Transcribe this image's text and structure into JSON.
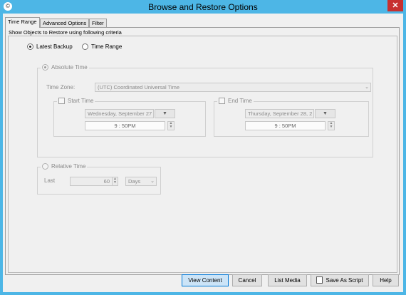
{
  "window": {
    "title": "Browse and Restore Options",
    "close_glyph": "✕",
    "app_icon": "©"
  },
  "tabs": [
    {
      "label": "Time Range",
      "active": true
    },
    {
      "label": "Advanced Options",
      "active": false
    },
    {
      "label": "Filter",
      "active": false
    }
  ],
  "panel": {
    "caption": "Show Objects to Restore using following criteria",
    "mode": {
      "latest_backup_label": "Latest Backup",
      "time_range_label": "Time Range",
      "selected": "Latest Backup"
    },
    "absolute_time": {
      "label": "Absolute Time",
      "timezone_label": "Time Zone:",
      "timezone_value": "(UTC) Coordinated Universal Time",
      "start": {
        "label": "Start Time",
        "date": "Wednesday, September 27",
        "time": "9 : 50PM"
      },
      "end": {
        "label": "End Time",
        "date": "Thursday, September 28, 2",
        "time": "9 : 50PM"
      }
    },
    "relative_time": {
      "label": "Relative Time",
      "last_label": "Last",
      "value": "60",
      "unit": "Days"
    }
  },
  "buttons": {
    "view_content": "View Content",
    "cancel": "Cancel",
    "list_media": "List Media",
    "save_as_script": "Save As Script",
    "help": "Help"
  },
  "icons": {
    "dropdown": "▼",
    "chevron": "⌄",
    "spin_up": "▲",
    "spin_down": "▼"
  },
  "colors": {
    "titlebar": "#4db6e6",
    "close": "#c7302f",
    "default_button": "#cce4f7"
  }
}
